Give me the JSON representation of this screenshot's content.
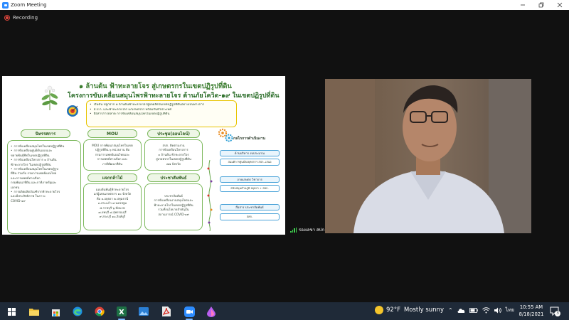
{
  "window": {
    "title": "Zoom Meeting"
  },
  "recording": {
    "label": "Recording"
  },
  "slide": {
    "title_line1": "๑ ล้านต้น ฟ้าทะลายโจร สู่เกษตรกรในเขตปฏิรูปที่ดิน",
    "title_line2": "โครงการขับเคลื่อนสมุนไพรฟ้าทะลายโจร ต้านภัยโควิด-๑๙ ในเขตปฏิรูปที่ดิน",
    "objectives": [
      "เริ่มต้น ปลูกจาก ๑ ล้านต้นฟ้าทะลายโจรสู่ผลผลิตในเขตปฏิรูปที่ดินอย่างเป็นทางการ",
      "ส.ป.ก. และฟ้าทะลายโจร แก่เกษตรกร พร้อมกันทั่วประเทศ",
      "สื่อสารการตลาด การขับเคลื่อนสมุนไพรในเขตปฏิรูปที่ดิน"
    ],
    "policy": {
      "header": "นิทรรศการ",
      "items": [
        "การขับเคลื่อนสมุนไพรในเขตปฏิรูปที่ดิน",
        "การขับเคลื่อนศูนย์ต้นแบบและ",
        "ขยายพันธุ์พืชในเขตปฏิรูปที่ดิน",
        "การขับเคลื่อนโครงการ ๑ ล้านต้น",
        "ฟ้าทะลายโจร ในเขตปฏิรูปที่ดิน",
        "การขับเคลื่อนสมุนไพรในเขตปฏิรูป",
        "ที่ดิน ร่วมกับ กรมการแพทย์แผนไทย",
        "และการแพทย์ทางเลือก",
        "กรมพัฒนาที่ดิน และภาคีภาครัฐและ",
        "เอกชน",
        "การผลิตผลิตภัณฑ์จากฟ้าทะลายโจร",
        "และมีประสิทธิภาพ ในภาวะ",
        "COVID-๑๙"
      ]
    },
    "mou": {
      "header": "MOU",
      "lines": [
        "MOU การพัฒนาสมุนไพรในเขต",
        "ปฏิรูปที่ดิน ๖ หน่วยงาน คือ",
        "กรมการแพทย์แผนไทยและ",
        "การแพทย์ทางเลือก และ",
        "ภาคีพัฒนาที่ดิน"
      ]
    },
    "distribution": {
      "header": "แจกกล้าไม้",
      "lines": [
        "มอบต้นพันธุ์ฟ้าทะลายโจร",
        "แก่ผู้แทนเกษตรกร ๑๐ จังหวัด",
        "คือ ๑.อยุธยา ๒.ปทุมธานี",
        "๓.สระแก้ว ๔.นครปฐม",
        "๕.ราชบุรี ๖.ชัยนาท",
        "๗.ลพบุรี ๘.สุพรรณบุรี",
        "๙.สระบุรี ๑๐.สิงห์บุรี"
      ]
    },
    "meeting": {
      "header": "ประชุม(ออนไลน์)",
      "lines": [
        "สปก. ติดตามงาน",
        "การขับเคลื่อนโครงการ",
        "๑ ล้านต้น ฟ้าทะลายโจร",
        "สู่เกษตรกรในเขตปฏิรูปที่ดิน",
        "๗๗ จังหวัด"
      ]
    },
    "pr": {
      "header": "ประชาสัมพันธ์",
      "lines": [
        "ประชาสัมพันธ์",
        "การขับเคลื่อนงานสมุนไพรและ",
        "ฟ้าทะลายโจรในเขตปฏิรูปที่ดิน",
        "รวมทั้งนโยบายสำคัญใน",
        "สถานการณ์ COVID-๑๙"
      ]
    },
    "process": {
      "title": "กลไกการดำเนินงาน",
      "steps": [
        {
          "head": "ด้านบริหาร งบประมาณ",
          "sub": "สมมติการศูนย์ต่อยุทธการ สปก.-เสนอ"
        },
        {
          "head": "ภาคเกษตร วิชาการ",
          "sub": "สนับสนุนด้านภูมิ อยุธยา + สคก."
        },
        {
          "head": "สื่อสาร ประชาสัมพันธ์",
          "sub": "สคก."
        }
      ]
    }
  },
  "participant": {
    "name": "รองเลขา สปก"
  },
  "taskbar": {
    "apps": [
      "windows-start",
      "file-explorer",
      "microsoft-store",
      "edge",
      "chrome",
      "excel",
      "photos",
      "acrobat",
      "zoom",
      "paint"
    ],
    "weather_temp": "92°F",
    "weather_text": "Mostly sunny",
    "language": "ไทย",
    "time": "10:55 AM",
    "date": "8/18/2021",
    "notification_count": "3"
  },
  "colors": {
    "zoom_blue": "#2d8cff",
    "slide_green": "#3a7c2e",
    "box_border": "#7cb85c",
    "objective_border": "#e8c400",
    "process_blue": "#4aa3d8",
    "taskbar": "#1f2a38",
    "recording_red": "#e0463c"
  }
}
